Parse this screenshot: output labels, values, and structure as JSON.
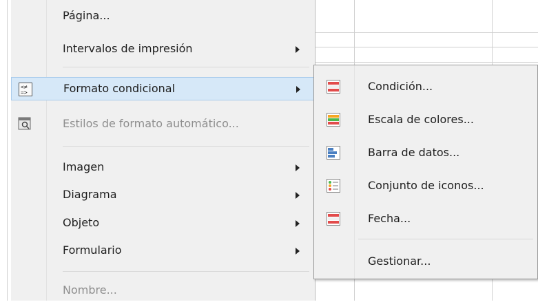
{
  "colors": {
    "highlight_bg": "#d6e8f8",
    "disabled_text": "#8e8e8e",
    "menu_bg": "#f0f0f0",
    "icon_red": "#e24b4b",
    "icon_orange": "#f5a623",
    "icon_green": "#4cb84c",
    "icon_blue": "#4a7fc1"
  },
  "menu": {
    "items": [
      {
        "label": "Página...",
        "icon": null,
        "submenu": false,
        "disabled": false
      },
      {
        "label": "Intervalos de impresión",
        "icon": null,
        "submenu": true,
        "disabled": false
      },
      {
        "label": "Formato condicional",
        "icon": "conditional-format-icon",
        "submenu": true,
        "disabled": false,
        "highlighted": true
      },
      {
        "label": "Estilos de formato automático...",
        "icon": "autoformat-icon",
        "submenu": false,
        "disabled": true
      },
      {
        "label": "Imagen",
        "icon": null,
        "submenu": true,
        "disabled": false
      },
      {
        "label": "Diagrama",
        "icon": null,
        "submenu": true,
        "disabled": false
      },
      {
        "label": "Objeto",
        "icon": null,
        "submenu": true,
        "disabled": false
      },
      {
        "label": "Formulario",
        "icon": null,
        "submenu": true,
        "disabled": false
      },
      {
        "label": "Nombre...",
        "icon": null,
        "submenu": false,
        "disabled": true
      }
    ]
  },
  "submenu": {
    "items": [
      {
        "label": "Condición...",
        "icon": "condition-icon"
      },
      {
        "label": "Escala de colores...",
        "icon": "color-scale-icon"
      },
      {
        "label": "Barra de datos...",
        "icon": "data-bar-icon"
      },
      {
        "label": "Conjunto de iconos...",
        "icon": "icon-set-icon"
      },
      {
        "label": "Fecha...",
        "icon": "date-format-icon"
      },
      {
        "label": "Gestionar...",
        "icon": null
      }
    ]
  }
}
